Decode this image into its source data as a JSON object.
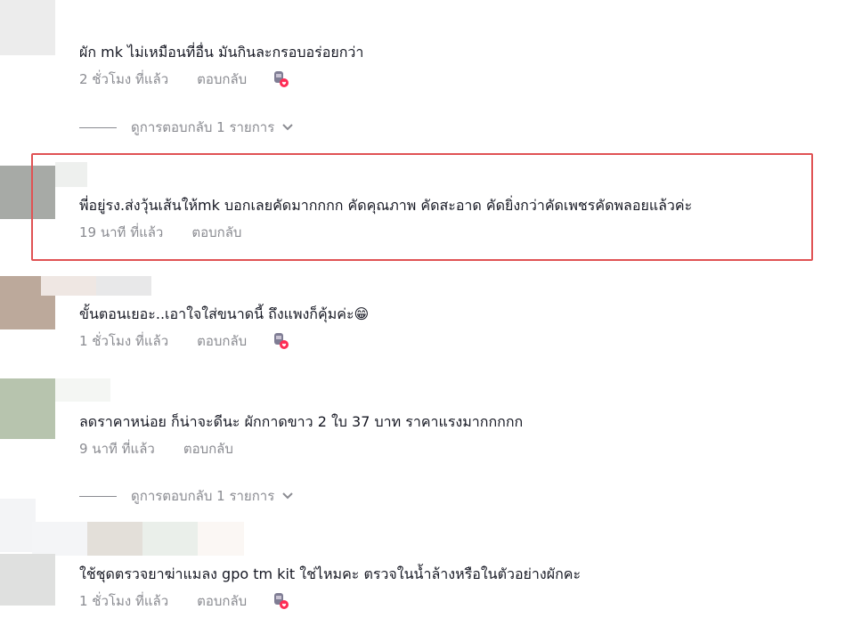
{
  "colors": {
    "highlight_border": "#e05254",
    "meta_text": "#8a8b91",
    "body_text": "#161823"
  },
  "comments": [
    {
      "text": "ผัก mk ไม่เหมือนที่อื่น มันกินละกรอบอร่อยกว่า",
      "time": "2 ชั่วโมง ที่แล้ว",
      "reply_label": "ตอบกลับ",
      "reaction_icon": "creator-like-icon"
    },
    {
      "text": "พี่อยู่รง.ส่งวุ้นเส้นให้mk บอกเลยคัดมากกกก คัดคุณภาพ คัดสะอาด คัดยิ่งกว่าคัดเพชรคัดพลอยแล้วค่ะ",
      "time": "19 นาที ที่แล้ว",
      "reply_label": "ตอบกลับ"
    },
    {
      "text": "ขั้นตอนเยอะ..เอาใจใส่ขนาดนี้ ถึงแพงก็คุ้มค่ะ😁",
      "time": "1 ชั่วโมง ที่แล้ว",
      "reply_label": "ตอบกลับ",
      "reaction_icon": "creator-like-icon"
    },
    {
      "text": "ลดราคาหน่อย ก็น่าจะดีนะ ผักกาดขาว 2 ใบ 37 บาท ราคาแรงมากกกกก",
      "time": "9 นาที ที่แล้ว",
      "reply_label": "ตอบกลับ"
    },
    {
      "text": "ใช้ชุดตรวจยาฆ่าแมลง gpo tm kit ใช่ไหมคะ ตรวจในน้ำล้างหรือในตัวอย่างผักคะ",
      "time": "1 ชั่วโมง ที่แล้ว",
      "reply_label": "ตอบกลับ",
      "reaction_icon": "creator-like-icon"
    }
  ],
  "view_replies": [
    {
      "label": "ดูการตอบกลับ 1 รายการ",
      "icon": "chevron-down-icon"
    },
    {
      "label": "ดูการตอบกลับ 1 รายการ",
      "icon": "chevron-down-icon"
    }
  ]
}
